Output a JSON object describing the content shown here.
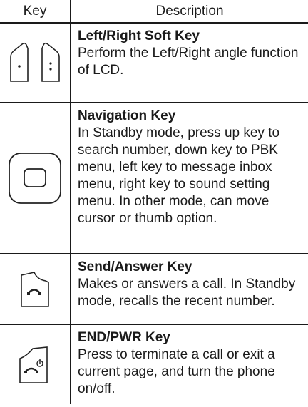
{
  "headers": {
    "key": "Key",
    "description": "Description"
  },
  "rows": [
    {
      "icon": "soft-keys-icon",
      "title": "Left/Right Soft Key",
      "body": "Perform the Left/Right angle function of LCD."
    },
    {
      "icon": "navigation-key-icon",
      "title": "Navigation Key",
      "body": "In Standby mode, press up key to search number, down key to PBK menu, left key to message inbox menu, right key to sound setting menu. In other mode, can move cursor or thumb option."
    },
    {
      "icon": "send-key-icon",
      "title": "Send/Answer Key",
      "body": "Makes or answers a call. In Standby mode, recalls the recent number."
    },
    {
      "icon": "end-power-key-icon",
      "title": "END/PWR Key",
      "body": "Press to terminate a call or exit a current page, and turn the phone on/off."
    }
  ]
}
